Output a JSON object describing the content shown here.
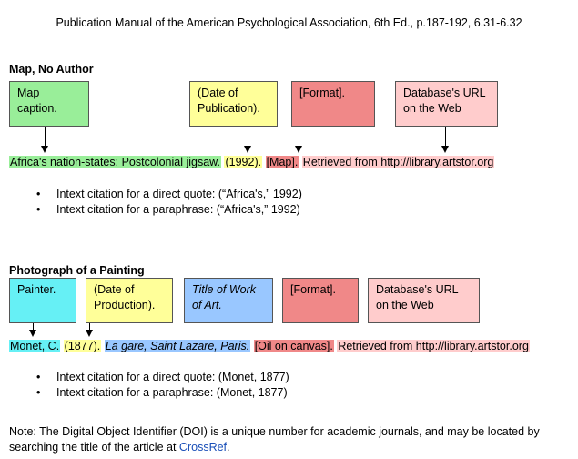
{
  "header": "Publication Manual of the American Psychological Association, 6th Ed., p.187-192, 6.31-6.32",
  "colors": {
    "green": "#99ee99",
    "yellow": "#ffff99",
    "red": "#f08888",
    "pink": "#ffcccc",
    "cyan": "#66f0f5",
    "blue": "#99c7ff"
  },
  "map_section": {
    "title": "Map, No Author",
    "boxes": {
      "caption": "Map\ncaption.",
      "date": "(Date of\nPublication).",
      "format": "[Format].",
      "url": "Database's URL\non the Web"
    },
    "citation": {
      "caption": "Africa's nation-states: Postcolonial jigsaw.",
      "date": "(1992).",
      "format": "[Map].",
      "url": "Retrieved from http://library.artstor.org"
    },
    "bullets": [
      "Intext citation for a direct quote: (“Africa's,” 1992)",
      "Intext citation for a paraphrase: (“Africa's,” 1992)"
    ]
  },
  "photo_section": {
    "title": "Photograph of a Painting",
    "boxes": {
      "painter": "Painter.",
      "date": "(Date of\nProduction).",
      "title": "Title of Work\nof Art.",
      "format": "[Format].",
      "url": "Database's URL\non the Web"
    },
    "citation": {
      "painter": "Monet, C.",
      "date": "(1877).",
      "title": "La gare, Saint Lazare, Paris.",
      "format": "[Oil on canvas].",
      "url": "Retrieved from http://library.artstor.org"
    },
    "bullets": [
      "Intext citation for a direct quote: (Monet, 1877)",
      "Intext citation for a paraphrase: (Monet, 1877)"
    ]
  },
  "note": {
    "text": "Note: The Digital Object Identifier (DOI) is a unique number for academic journals, and may be located by searching the title of the article at ",
    "link": "CrossRef",
    "end": "."
  }
}
